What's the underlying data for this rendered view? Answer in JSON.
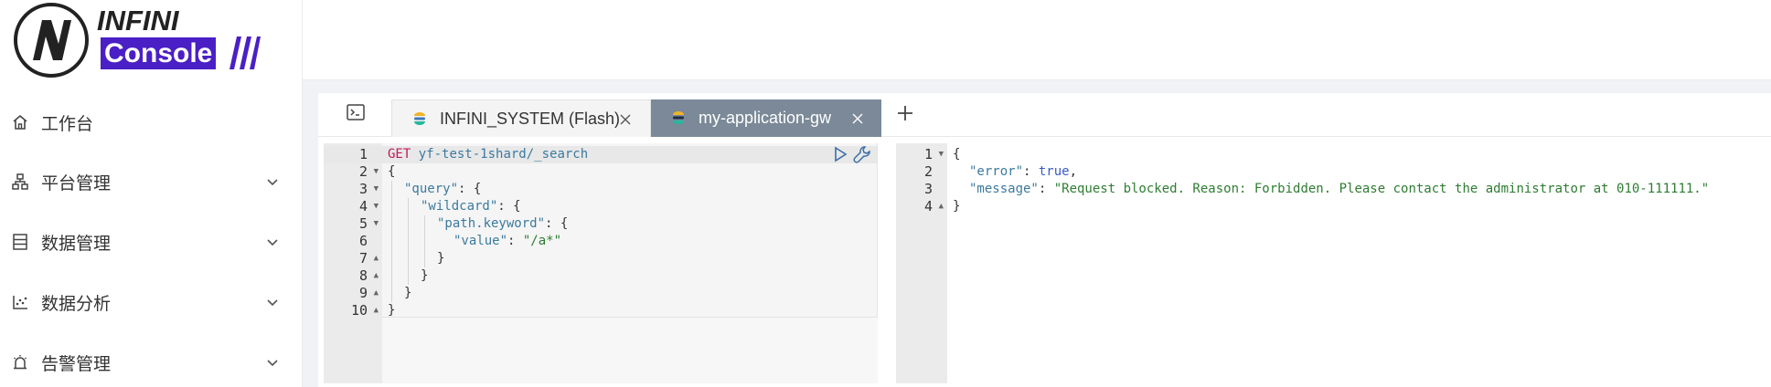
{
  "brand": {
    "line1": "INFINI",
    "line2": "Console",
    "accent_color": "#4a1fc5"
  },
  "sidebar": {
    "items": [
      {
        "label": "工作台",
        "icon": "home-icon",
        "has_chevron": false
      },
      {
        "label": "平台管理",
        "icon": "cluster-icon",
        "has_chevron": true
      },
      {
        "label": "数据管理",
        "icon": "database-icon",
        "has_chevron": true
      },
      {
        "label": "数据分析",
        "icon": "chart-icon",
        "has_chevron": true
      },
      {
        "label": "告警管理",
        "icon": "alarm-icon",
        "has_chevron": true
      }
    ]
  },
  "tabs": [
    {
      "label": "INFINI_SYSTEM (Flash)",
      "active": false
    },
    {
      "label": "my-application-gw",
      "active": true
    }
  ],
  "request_editor": {
    "line_numbers": [
      "1",
      "2",
      "3",
      "4",
      "5",
      "6",
      "7",
      "8",
      "9",
      "10"
    ],
    "method": "GET",
    "path": "yf-test-1shard/_search",
    "lines": {
      "l2": "{",
      "l3_key": "\"query\"",
      "l3_rest": ": {",
      "l4_key": "\"wildcard\"",
      "l4_rest": ": {",
      "l5_key": "\"path.keyword\"",
      "l5_rest": ": {",
      "l6_key": "\"value\"",
      "l6_sep": ": ",
      "l6_val": "\"/a*\"",
      "l7": "}",
      "l8": "}",
      "l9": "}",
      "l10": "}"
    }
  },
  "response_editor": {
    "line_numbers": [
      "1",
      "2",
      "3",
      "4"
    ],
    "lines": {
      "l1": "{",
      "l2_key": "\"error\"",
      "l2_sep": ": ",
      "l2_val": "true",
      "l2_end": ",",
      "l3_key": "\"message\"",
      "l3_sep": ": ",
      "l3_val": "\"Request blocked. Reason: Forbidden. Please contact the administrator at 010-111111.\"",
      "l4": "}"
    }
  }
}
